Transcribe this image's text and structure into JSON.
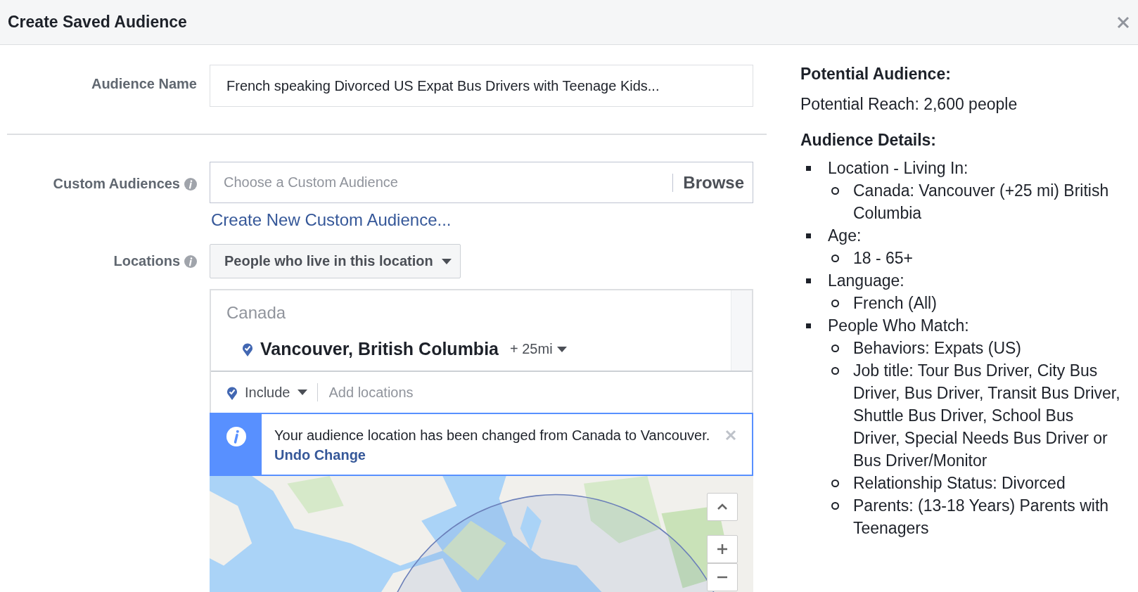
{
  "dialog": {
    "title": "Create Saved Audience"
  },
  "form": {
    "audience_name": {
      "label": "Audience Name",
      "value": "French speaking Divorced US Expat Bus Drivers with Teenage Kids..."
    },
    "custom_audiences": {
      "label": "Custom Audiences",
      "placeholder": "Choose a Custom Audience",
      "browse_button": "Browse",
      "create_link": "Create New Custom Audience..."
    },
    "locations": {
      "label": "Locations",
      "dropdown": "People who live in this location",
      "country": "Canada",
      "location": {
        "name": "Vancouver, British Columbia",
        "radius": "+ 25mi"
      },
      "include": "Include",
      "add_placeholder": "Add locations",
      "notice": {
        "text": "Your audience location has been changed from Canada to Vancouver.",
        "link": "Undo Change"
      }
    }
  },
  "summary": {
    "heading": "Potential Audience:",
    "reach": "Potential Reach: 2,600 people",
    "details_heading": "Audience Details:",
    "details": [
      {
        "label": "Location - Living In:",
        "children": [
          {
            "label": "Canada: Vancouver (+25 mi) British Columbia"
          }
        ]
      },
      {
        "label": "Age:",
        "children": [
          {
            "label": "18 - 65+"
          }
        ]
      },
      {
        "label": "Language:",
        "children": [
          {
            "label": "French (All)"
          }
        ]
      },
      {
        "label": "People Who Match:",
        "children": [
          {
            "label": "Behaviors: Expats (US)"
          },
          {
            "label": "Job title: Tour Bus Driver, City Bus Driver, Bus Driver, Transit Bus Driver, Shuttle Bus Driver, School Bus Driver, Special Needs Bus Driver or Bus Driver/Monitor"
          },
          {
            "label": "Relationship Status: Divorced"
          },
          {
            "label": "Parents: (13-18 Years) Parents with Teenagers"
          }
        ]
      }
    ]
  }
}
